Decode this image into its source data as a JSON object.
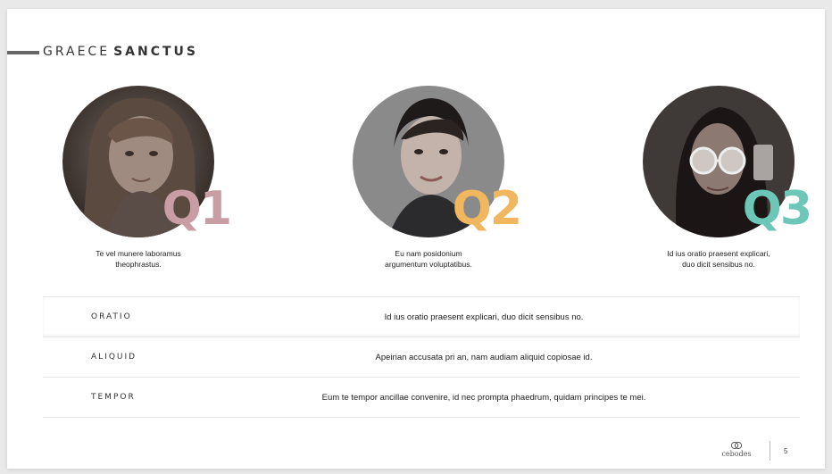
{
  "title": {
    "part1": "GRAECE",
    "part2": "SANCTUS"
  },
  "colors": {
    "q1": "#c89ea4",
    "q2": "#f0b75e",
    "q3": "#6cc7b8"
  },
  "cards": [
    {
      "label": "Q1",
      "caption": "Te vel munere laboramus\ntheophrastus."
    },
    {
      "label": "Q2",
      "caption": "Eu nam posidonium\nargumentum voluptatibus."
    },
    {
      "label": "Q3",
      "caption": "Id ius oratio praesent explicari,\nduo dicit sensibus no."
    }
  ],
  "rows": [
    {
      "key": "ORATIO",
      "value": "Id ius oratio praesent explicari, duo dicit sensibus no."
    },
    {
      "key": "ALIQUID",
      "value": "Apeirian accusata pri an, nam audiam aliquid copiosae id."
    },
    {
      "key": "TEMPOR",
      "value": "Eum te tempor ancillae convenire, id nec prompta phaedrum, quidam principes te mei."
    }
  ],
  "footer": {
    "brand": "cebodes",
    "page": "5"
  }
}
